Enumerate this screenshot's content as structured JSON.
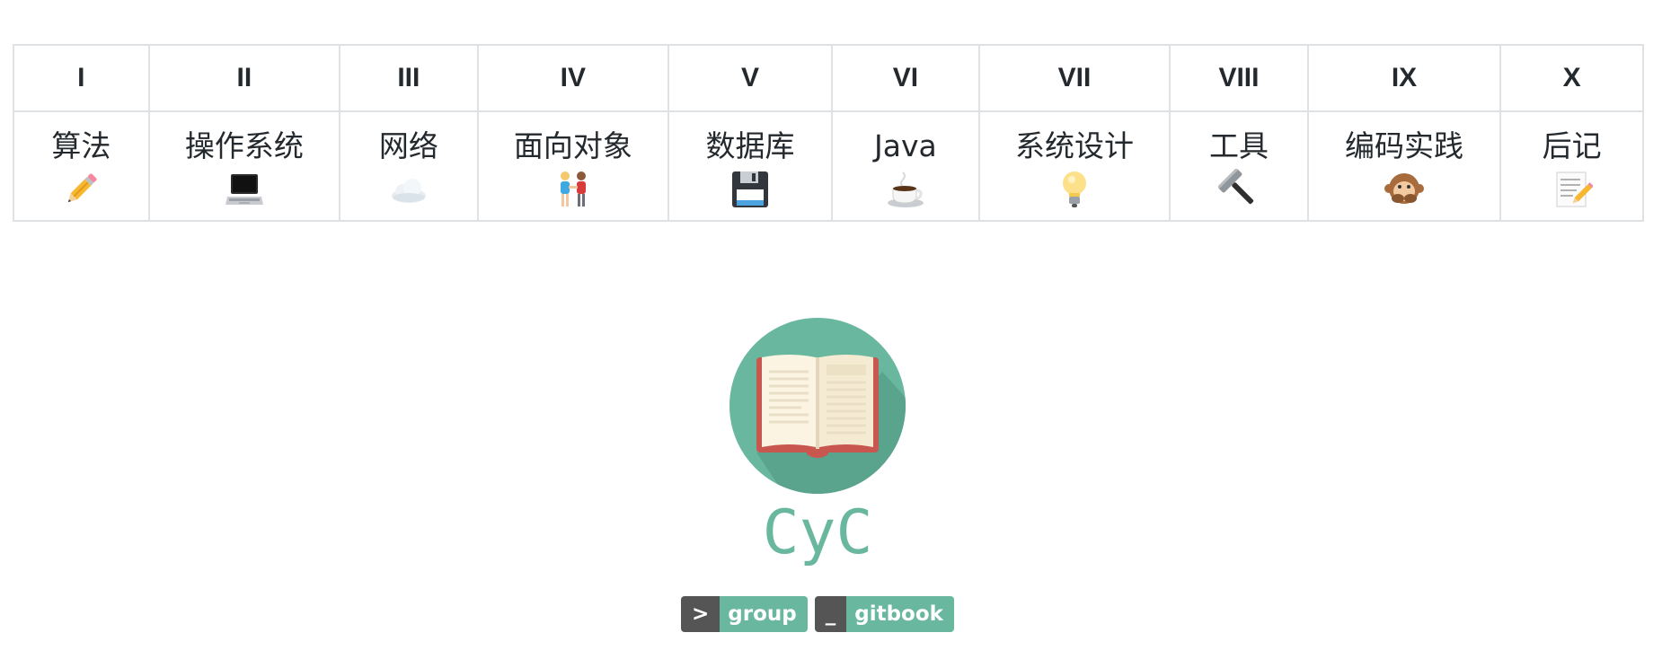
{
  "toc": {
    "headers": [
      "I",
      "II",
      "III",
      "IV",
      "V",
      "VI",
      "VII",
      "VIII",
      "IX",
      "X"
    ],
    "columns": [
      {
        "label": "算法",
        "icon": "pencil-icon"
      },
      {
        "label": "操作系统",
        "icon": "laptop-icon"
      },
      {
        "label": "网络",
        "icon": "cloud-icon"
      },
      {
        "label": "面向对象",
        "icon": "couple-icon"
      },
      {
        "label": "数据库",
        "icon": "floppy-disk-icon"
      },
      {
        "label": "Java",
        "icon": "coffee-icon"
      },
      {
        "label": "系统设计",
        "icon": "light-bulb-icon"
      },
      {
        "label": "工具",
        "icon": "hammer-icon"
      },
      {
        "label": "编码实践",
        "icon": "speak-no-evil-monkey-icon"
      },
      {
        "label": "后记",
        "icon": "memo-icon"
      }
    ]
  },
  "logo": {
    "icon": "open-book-icon",
    "circle_color": "#6ab7a0",
    "text": "CyC"
  },
  "badges": [
    {
      "left": ">",
      "right": "group",
      "color": "#6ab7a0"
    },
    {
      "left": "_",
      "right": "gitbook",
      "color": "#6ab7a0"
    }
  ],
  "colors": {
    "accent": "#6ab7a0",
    "badge_left": "#555555",
    "table_border": "#dfe2e5",
    "text": "#24292e"
  }
}
